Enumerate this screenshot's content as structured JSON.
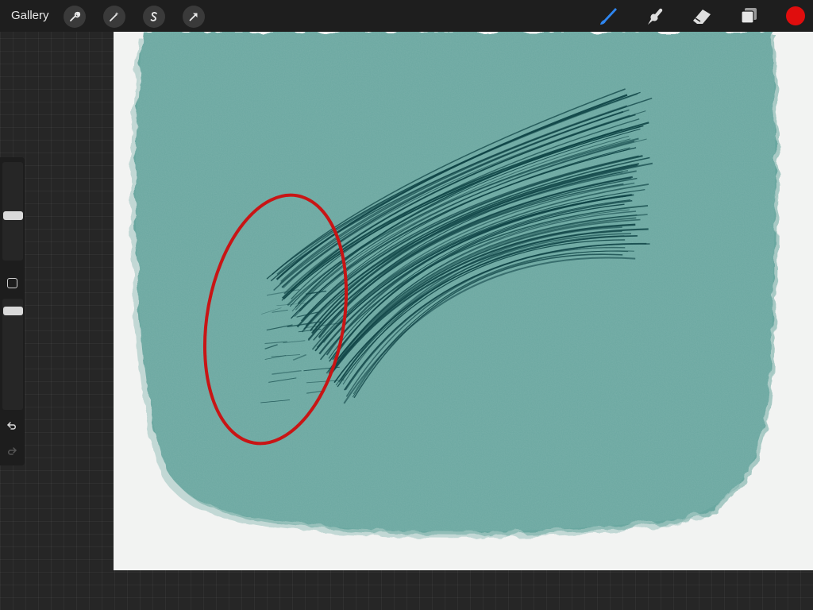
{
  "toolbar": {
    "gallery_label": "Gallery",
    "left_tools": [
      {
        "name": "actions-wrench-icon"
      },
      {
        "name": "adjustments-magic-wand-icon"
      },
      {
        "name": "selection-s-icon"
      },
      {
        "name": "transform-arrow-icon"
      }
    ],
    "right_tools": [
      {
        "name": "brush-icon",
        "active": true
      },
      {
        "name": "smudge-icon",
        "active": false
      },
      {
        "name": "eraser-icon",
        "active": false
      },
      {
        "name": "layers-icon",
        "active": false
      }
    ],
    "current_color": "#e00d0d"
  },
  "sidebar": {
    "brush_size_level": 0.45,
    "opacity_level": 0.92,
    "modify_button_icon": "square-icon",
    "undo_icon": "undo-icon",
    "redo_icon": "redo-icon"
  },
  "canvas": {
    "background_color": "#f2f3f2",
    "paint_color": "#6aa7a0",
    "stroke_color": "#0f4446",
    "annotation_color": "#c81515"
  }
}
